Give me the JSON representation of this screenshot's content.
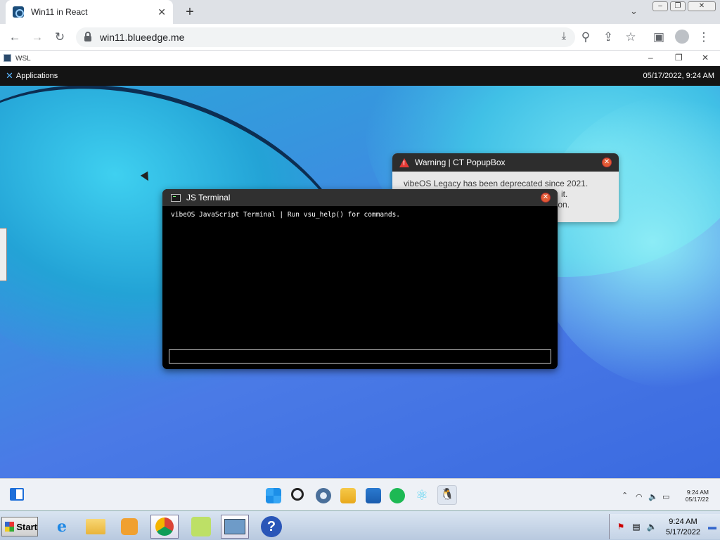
{
  "browser": {
    "tab_title": "Win11 in React",
    "tab_close": "✕",
    "new_tab": "+",
    "url": "win11.blueedge.me"
  },
  "wsl_window": {
    "title": "WSL"
  },
  "desktop": {
    "menu_label": "Applications",
    "datetime": "05/17/2022, 9:24 AM"
  },
  "popup": {
    "title": "Warning | CT PopupBox",
    "lines": [
      "vibeOS Legacy has been deprecated since 2021.",
      "it.",
      "nation."
    ]
  },
  "terminal": {
    "title": "JS Terminal",
    "output": "vibeOS JavaScript Terminal | Run vsu_help() for commands.",
    "input_value": ""
  },
  "win11_taskbar": {
    "time": "9:24 AM",
    "date": "05/17/22",
    "apps": [
      "start",
      "search",
      "settings",
      "file-explorer",
      "store",
      "spotify",
      "react",
      "wsl"
    ]
  },
  "host_taskbar": {
    "start_label": "Start",
    "time": "9:24 AM",
    "date": "5/17/2022"
  },
  "colors": {
    "desktop_accent": "#3b8fe0",
    "close_button": "#e35b34",
    "warning_icon": "#e53935"
  }
}
